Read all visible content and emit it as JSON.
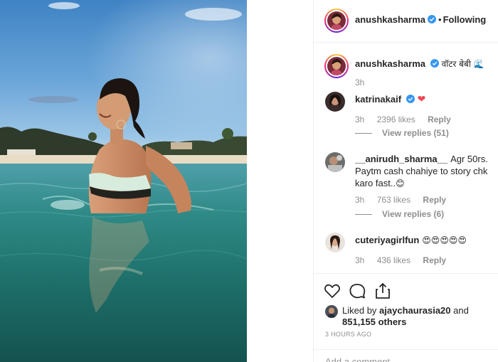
{
  "post": {
    "author": "anushkasharma",
    "follow_state": "Following",
    "separator": "•"
  },
  "caption": {
    "username": "anushkasharma",
    "text": "वॉटर बेबी",
    "emoji": "🌊",
    "time": "3h"
  },
  "comments": [
    {
      "username": "katrinakaif",
      "verified": true,
      "text": "",
      "emoji": "❤",
      "time": "3h",
      "likes": "2396 likes",
      "reply_label": "Reply",
      "view_replies": "View replies (51)"
    },
    {
      "username": "__anirudh_sharma__",
      "verified": false,
      "text": "Agr 50rs. Paytm cash chahiye to story chk karo fast..",
      "emoji": "😊",
      "time": "3h",
      "likes": "763 likes",
      "reply_label": "Reply",
      "view_replies": "View replies (6)"
    },
    {
      "username": "cuteriyagirlfun",
      "verified": false,
      "text": "",
      "emoji": "😍😍😍😍😍",
      "time": "3h",
      "likes": "436 likes",
      "reply_label": "Reply"
    }
  ],
  "actions": {
    "like_icon": "heart-outline-icon",
    "comment_icon": "comment-bubble-icon",
    "share_icon": "share-upload-icon"
  },
  "likes": {
    "prefix": "Liked by",
    "user": "ajaychaurasia20",
    "conjunction": "and",
    "count": "851,155 others"
  },
  "timestamp": "3 HOURS AGO",
  "add_comment": {
    "placeholder": "Add a comment..."
  },
  "colors": {
    "verified_blue": "#3897f0",
    "text": "#262626",
    "muted": "#8e8e8e",
    "border": "#efefef",
    "heart_red": "#ed4956"
  }
}
